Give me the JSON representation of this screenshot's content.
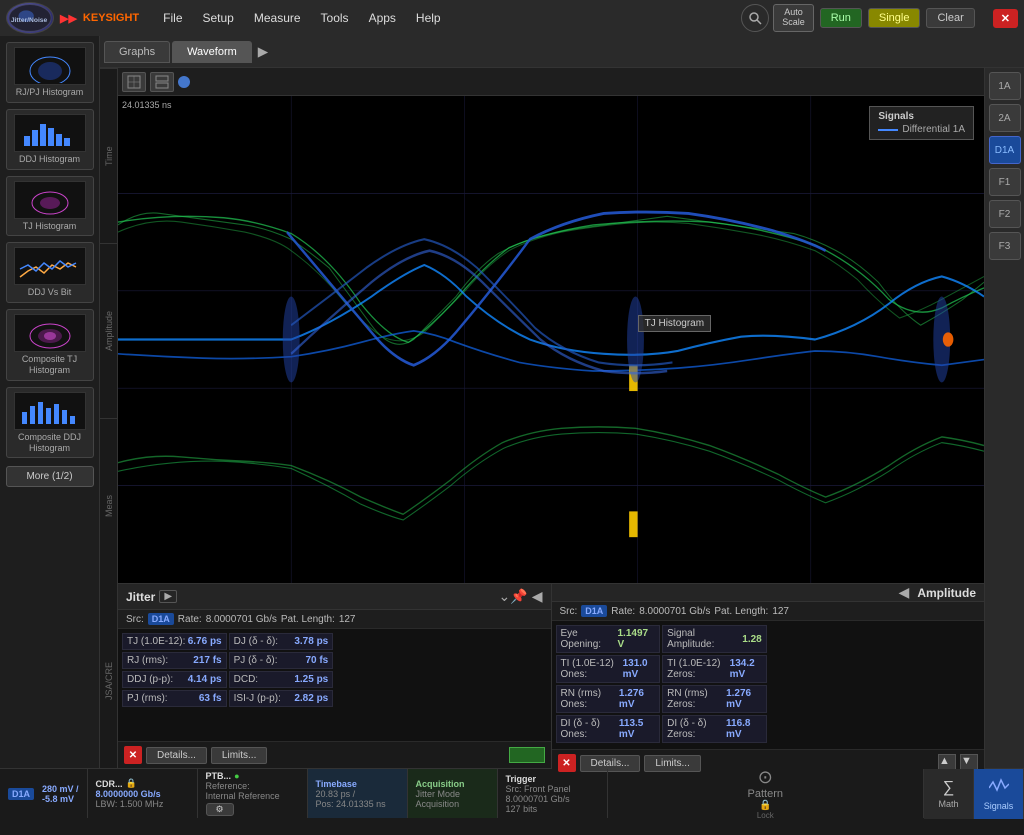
{
  "app": {
    "title": "Jitter/Noise",
    "keysight": "KEYSIGHT"
  },
  "menu": {
    "items": [
      "File",
      "Setup",
      "Measure",
      "Tools",
      "Apps",
      "Help"
    ]
  },
  "toolbar": {
    "autoscale": "Auto\nScale",
    "run": "Run",
    "single": "Single",
    "clear": "Clear"
  },
  "tabs": {
    "graphs": "Graphs",
    "waveform": "Waveform"
  },
  "waveform": {
    "time_label": "24.01335 ns"
  },
  "side_tabs": {
    "time": "Time",
    "amplitude": "Amplitude",
    "meas": "Meas",
    "jsa_cre": "JSA/CRE"
  },
  "signals": {
    "title": "Signals",
    "differential": "Differential 1A"
  },
  "tj_label": "TJ Histogram",
  "channels": {
    "ch1a": "1A",
    "ch2a": "2A",
    "chD1A": "D1A",
    "chF1": "F1",
    "chF2": "F2",
    "chF3": "F3"
  },
  "sidebar_items": [
    {
      "label": "RJ/PJ\nHistogram"
    },
    {
      "label": "DDJ Histogram"
    },
    {
      "label": "TJ Histogram"
    },
    {
      "label": "DDJ Vs Bit"
    },
    {
      "label": "Composite TJ\nHistogram"
    },
    {
      "label": "Composite DDJ\nHistogram"
    }
  ],
  "sidebar_more": "More (1/2)",
  "jitter": {
    "title": "Jitter",
    "src_label": "Src:",
    "src_badge": "D1A",
    "rate_label": "Rate:",
    "rate_value": "8.0000701 Gb/s",
    "pat_label": "Pat. Length:",
    "pat_value": "127",
    "measurements": [
      {
        "label": "TJ (1.0E-12):",
        "value": "6.76 ps"
      },
      {
        "label": "RJ (rms):",
        "value": "217 fs"
      },
      {
        "label": "DDJ (p-p):",
        "value": "4.14 ps"
      },
      {
        "label": "PJ (rms):",
        "value": "63 fs"
      },
      {
        "label": "DJ (δ - δ):",
        "value": "3.78 ps"
      },
      {
        "label": "PJ (δ - δ):",
        "value": "70 fs"
      },
      {
        "label": "DCD:",
        "value": "1.25 ps"
      },
      {
        "label": "ISI-J (p-p):",
        "value": "2.82 ps"
      }
    ]
  },
  "amplitude": {
    "title": "Amplitude",
    "src_label": "Src:",
    "src_badge": "D1A",
    "rate_label": "Rate:",
    "rate_value": "8.0000701 Gb/s",
    "pat_label": "Pat. Length:",
    "pat_value": "127",
    "measurements": [
      {
        "label": "Eye Opening:",
        "value": "1.1497 V"
      },
      {
        "label": "TI (1.0E-12) Ones:",
        "value": "131.0 mV"
      },
      {
        "label": "RN (rms) Ones:",
        "value": "1.276 mV"
      },
      {
        "label": "DI (δ - δ) Ones:",
        "value": "113.5 mV"
      },
      {
        "label": "Signal Amplitude:",
        "value": "1.28"
      },
      {
        "label": "TI (1.0E-12) Zeros:",
        "value": "134.2 mV"
      },
      {
        "label": "RN (rms) Zeros:",
        "value": "1.276 mV"
      },
      {
        "label": "DI (δ - δ) Zeros:",
        "value": "116.8 mV"
      }
    ]
  },
  "footer_buttons": {
    "details": "Details...",
    "limits": "Limits..."
  },
  "status_bar": {
    "voltage": "280 mV /",
    "voltage2": "-5.8 mV",
    "cdr_title": "CDR...",
    "cdr_rate": "8.0000000 Gb/s",
    "cdr_lbw": "LBW: 1.500 MHz",
    "ptb_title": "PTB...",
    "ptb_ref": "Reference:",
    "ptb_src": "Internal Reference",
    "timebase_title": "Timebase",
    "timebase_rate": "20.83 ps /",
    "timebase_pos": "Pos: 24.01335 ns",
    "acq_title": "Acquisition",
    "acq_mode": "Jitter Mode",
    "acq_sub": "Acquisition",
    "trig_title": "Trigger",
    "trig_src": "Src: Front Panel",
    "trig_rate": "8.0000701 Gb/s",
    "trig_bits": "127 bits",
    "pattern_label": "Pattern",
    "math_label": "Math",
    "signals_label": "Signals"
  }
}
